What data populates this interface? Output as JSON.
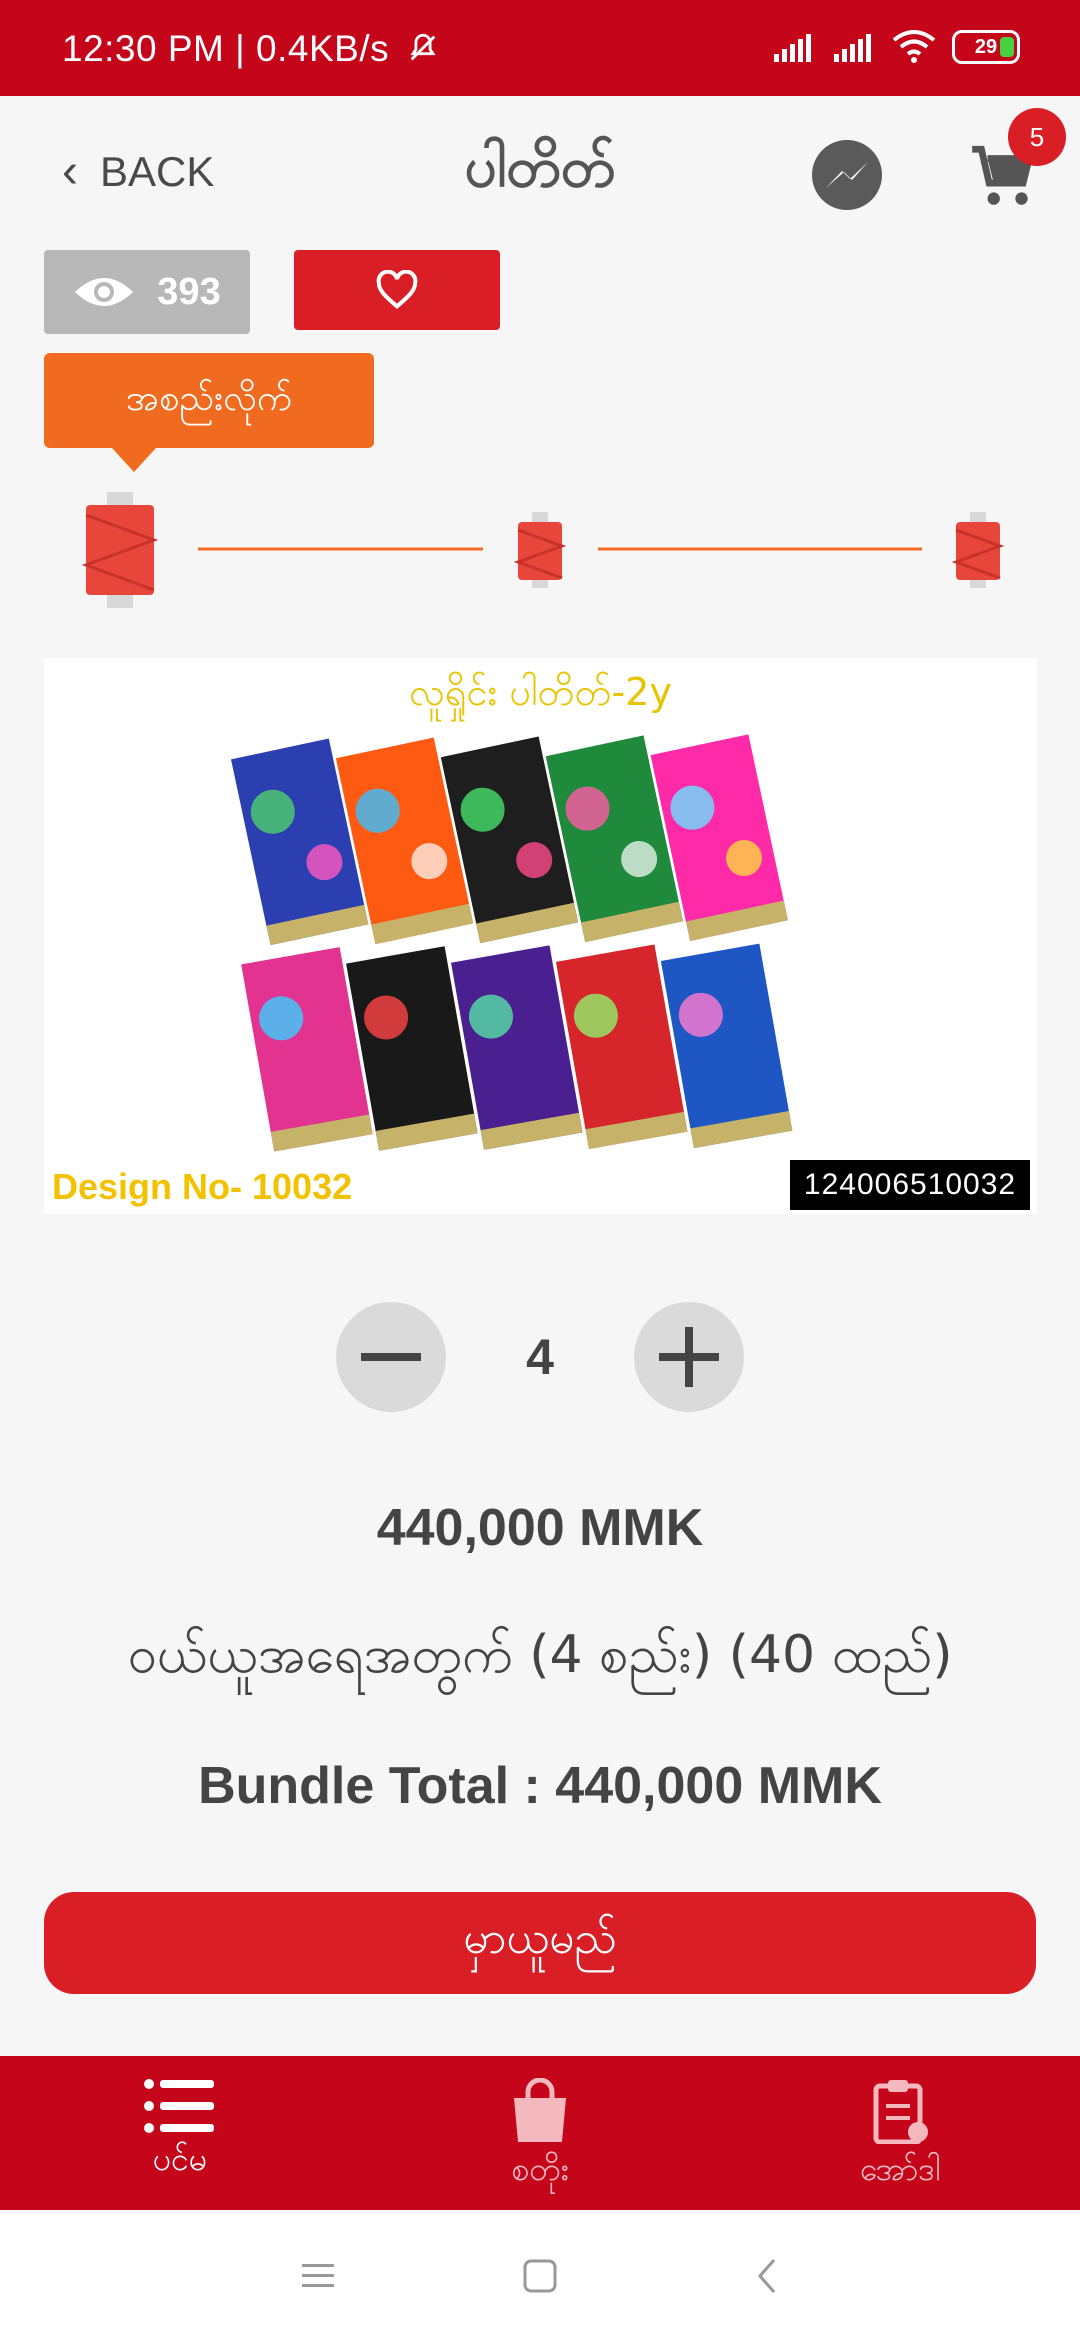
{
  "status_bar": {
    "time_net": "12:30 PM | 0.4KB/s",
    "battery": "29",
    "colors": {
      "bg": "#c4051a",
      "battery_fill": "#46d140"
    }
  },
  "header": {
    "back_label": "BACK",
    "title": "ပါတိတ်",
    "cart_count": "5"
  },
  "stats": {
    "views": "393"
  },
  "tooltip": {
    "label": "အစည်းလိုက်"
  },
  "product_image": {
    "title": "လူရှိုင်း ပါတိတ်-2y",
    "design_no": "Design No- 10032",
    "code": "124006510032"
  },
  "quantity": {
    "value": "4"
  },
  "pricing": {
    "price": "440,000 MMK",
    "note": "ဝယ်ယူအရေအတွက် (4 စည်း) (40 ထည်)",
    "bundle_total": "Bundle Total : 440,000 MMK"
  },
  "buy_button": {
    "label": "မှာယူမည်"
  },
  "bottom_nav": {
    "items": [
      {
        "label": "ပင်မ",
        "icon": "list-icon",
        "active": true
      },
      {
        "label": "စတိုး",
        "icon": "shopping-bag-icon",
        "active": false
      },
      {
        "label": "အော်ဒါ",
        "icon": "clipboard-icon",
        "active": false
      }
    ]
  },
  "colors": {
    "primary": "#d91e26",
    "header_red": "#c4051a",
    "accent_orange": "#f06a1f",
    "spool_red": "#e8463a"
  }
}
